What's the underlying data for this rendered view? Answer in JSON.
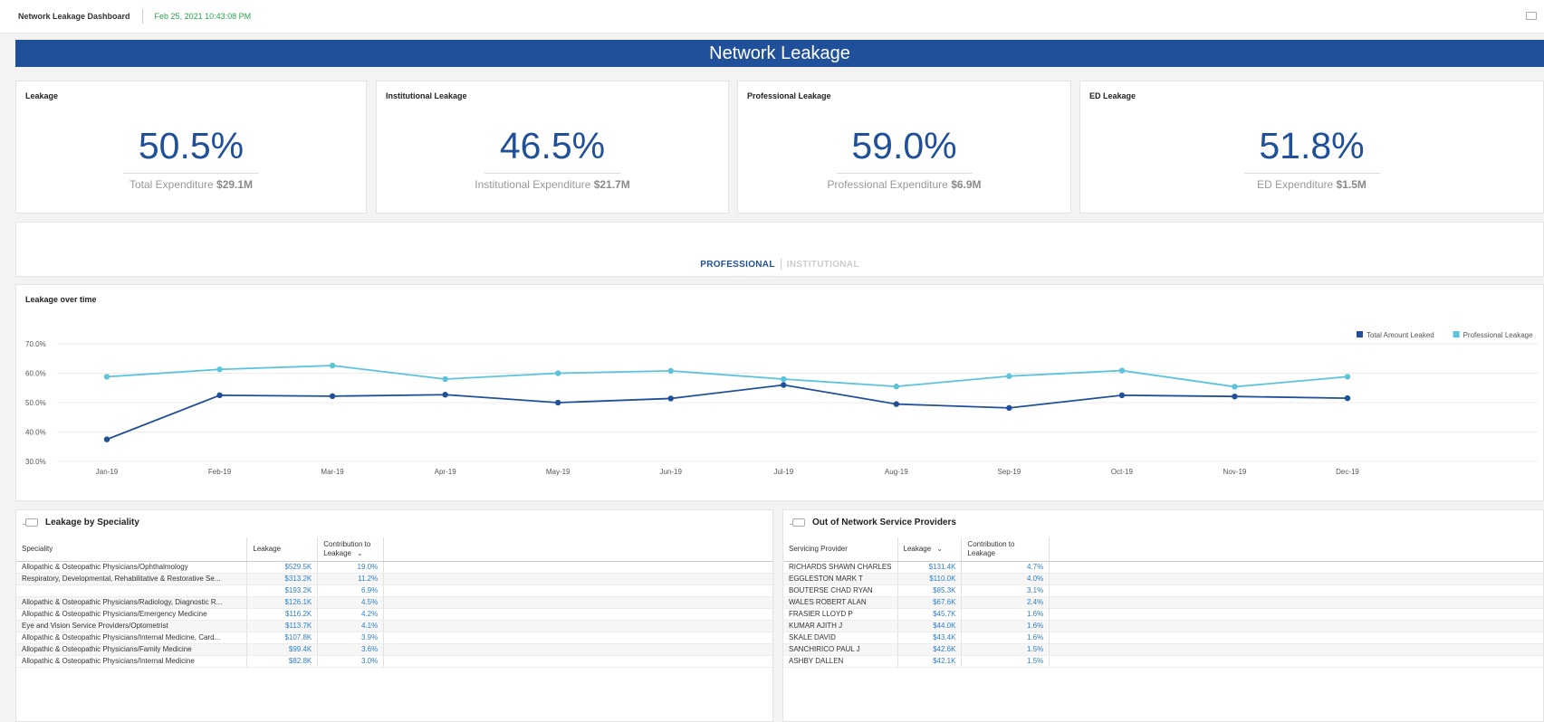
{
  "topbar": {
    "title": "Network Leakage Dashboard",
    "timestamp": "Feb 25, 2021 10:43:08 PM"
  },
  "banner": "Network Leakage",
  "kpis": [
    {
      "label": "Leakage",
      "value": "50.5%",
      "sub_label": "Total Expenditure",
      "sub_value": "$29.1M"
    },
    {
      "label": "Institutional Leakage",
      "value": "46.5%",
      "sub_label": "Institutional Expenditure",
      "sub_value": "$21.7M"
    },
    {
      "label": "Professional Leakage",
      "value": "59.0%",
      "sub_label": "Professional Expenditure",
      "sub_value": "$6.9M"
    },
    {
      "label": "ED Leakage",
      "value": "51.8%",
      "sub_label": "ED Expenditure",
      "sub_value": "$1.5M"
    }
  ],
  "tabs": {
    "active": "PROFESSIONAL",
    "inactive": "INSTITUTIONAL"
  },
  "chart_data": {
    "type": "line",
    "title": "Leakage over time",
    "categories": [
      "Jan-19",
      "Feb-19",
      "Mar-19",
      "Apr-19",
      "May-19",
      "Jun-19",
      "Jul-19",
      "Aug-19",
      "Sep-19",
      "Oct-19",
      "Nov-19",
      "Dec-19"
    ],
    "series": [
      {
        "name": "Total Amount Leaked",
        "color": "#21509a",
        "values": [
          37.5,
          52.5,
          52.2,
          52.7,
          50.0,
          51.4,
          56.0,
          49.5,
          48.2,
          52.5,
          52.1,
          51.5
        ]
      },
      {
        "name": "Professional Leakage",
        "color": "#5bc4dc",
        "values": [
          58.8,
          61.3,
          62.6,
          58.0,
          60.0,
          60.8,
          58.0,
          55.5,
          59.0,
          60.9,
          55.4,
          58.8
        ]
      }
    ],
    "yticks": [
      "70.0%",
      "60.0%",
      "50.0%",
      "40.0%",
      "30.0%"
    ],
    "ylim": [
      30,
      70
    ],
    "grid": true,
    "legend": "top-right"
  },
  "speciality_table": {
    "title": "Leakage by Speciality",
    "columns": [
      "Speciality",
      "Leakage",
      "Contribution to Leakage"
    ],
    "rows": [
      [
        "Allopathic & Osteopathic Physicians/Ophthalmology",
        "$529.5K",
        "19.0%"
      ],
      [
        "Respiratory, Developmental, Rehabilitative & Restorative Se...",
        "$313.2K",
        "11.2%"
      ],
      [
        "",
        "$193.2K",
        "6.9%"
      ],
      [
        "Allopathic & Osteopathic Physicians/Radiology, Diagnostic R...",
        "$126.1K",
        "4.5%"
      ],
      [
        "Allopathic & Osteopathic Physicians/Emergency Medicine",
        "$116.2K",
        "4.2%"
      ],
      [
        "Eye and Vision Service Providers/Optometrist",
        "$113.7K",
        "4.1%"
      ],
      [
        "Allopathic & Osteopathic Physicians/Internal Medicine, Card...",
        "$107.8K",
        "3.9%"
      ],
      [
        "Allopathic & Osteopathic Physicians/Family Medicine",
        "$99.4K",
        "3.6%"
      ],
      [
        "Allopathic & Osteopathic Physicians/Internal Medicine",
        "$82.8K",
        "3.0%"
      ]
    ]
  },
  "provider_table": {
    "title": "Out of Network Service Providers",
    "columns": [
      "Servicing Provider",
      "Leakage",
      "Contribution to Leakage"
    ],
    "rows": [
      [
        "RICHARDS SHAWN CHARLES",
        "$131.4K",
        "4.7%"
      ],
      [
        "EGGLESTON MARK T",
        "$110.0K",
        "4.0%"
      ],
      [
        "BOUTERSE CHAD RYAN",
        "$85.3K",
        "3.1%"
      ],
      [
        "WALES ROBERT ALAN",
        "$67.6K",
        "2.4%"
      ],
      [
        "FRASIER LLOYD P",
        "$45.7K",
        "1.6%"
      ],
      [
        "KUMAR AJITH J",
        "$44.0K",
        "1.6%"
      ],
      [
        "SKALE DAVID",
        "$43.4K",
        "1.6%"
      ],
      [
        "SANCHIRICO PAUL J",
        "$42.6K",
        "1.5%"
      ],
      [
        "ASHBY DALLEN",
        "$42.1K",
        "1.5%"
      ]
    ]
  }
}
